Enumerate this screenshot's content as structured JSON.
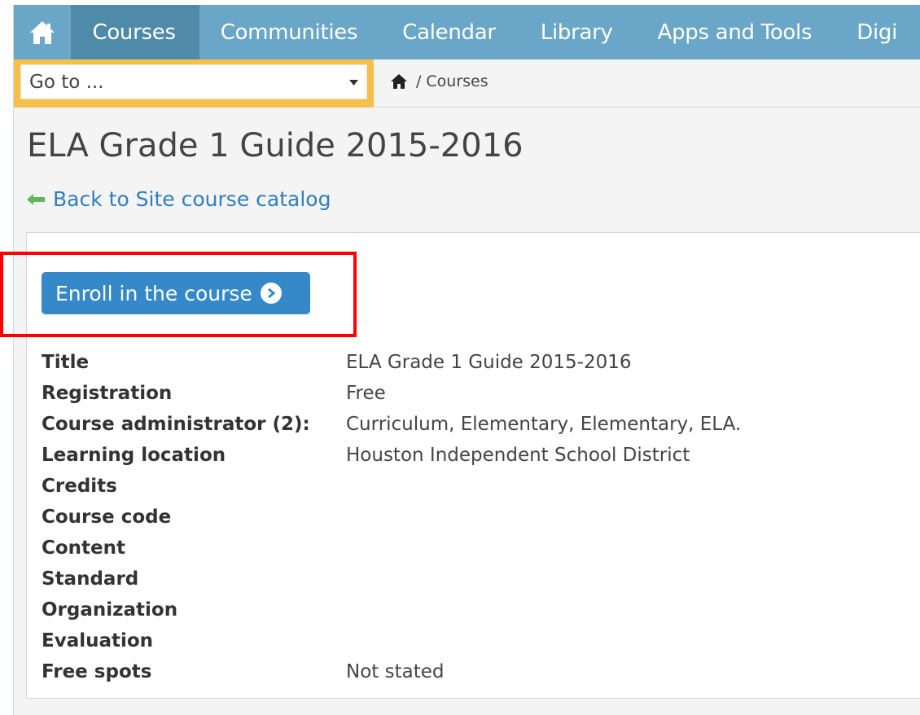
{
  "nav": {
    "items": [
      {
        "label": "Courses",
        "active": true
      },
      {
        "label": "Communities",
        "active": false
      },
      {
        "label": "Calendar",
        "active": false
      },
      {
        "label": "Library",
        "active": false
      },
      {
        "label": "Apps and Tools",
        "active": false
      },
      {
        "label": "Digi",
        "active": false
      }
    ]
  },
  "goto": {
    "value": "Go to ..."
  },
  "breadcrumb": {
    "separator": "/",
    "current": "Courses"
  },
  "page": {
    "title": "ELA Grade 1 Guide 2015-2016",
    "back_link": "Back to Site course catalog",
    "enroll_label": "Enroll in the course"
  },
  "details": [
    {
      "key": "Title",
      "value": "ELA Grade 1 Guide 2015-2016"
    },
    {
      "key": "Registration",
      "value": "Free"
    },
    {
      "key": "Course administrator (2):",
      "value": "Curriculum, Elementary, Elementary, ELA."
    },
    {
      "key": "Learning location",
      "value": "Houston Independent School District"
    },
    {
      "key": "Credits",
      "value": ""
    },
    {
      "key": "Course code",
      "value": ""
    },
    {
      "key": "Content",
      "value": ""
    },
    {
      "key": "Standard",
      "value": ""
    },
    {
      "key": "Organization",
      "value": ""
    },
    {
      "key": "Evaluation",
      "value": ""
    },
    {
      "key": "Free spots",
      "value": "Not stated"
    }
  ],
  "colors": {
    "nav_bg": "#6aa6c8",
    "nav_active": "#4f8aa9",
    "goto_accent": "#f5c04a",
    "link": "#2f7ec0",
    "button": "#3589c9",
    "back_arrow": "#5cb85c",
    "highlight": "#ff0000"
  },
  "icons": {
    "home": "home-icon",
    "dropdown": "caret-down-icon",
    "back": "arrow-left-icon",
    "enroll": "chevron-circle-right-icon"
  }
}
